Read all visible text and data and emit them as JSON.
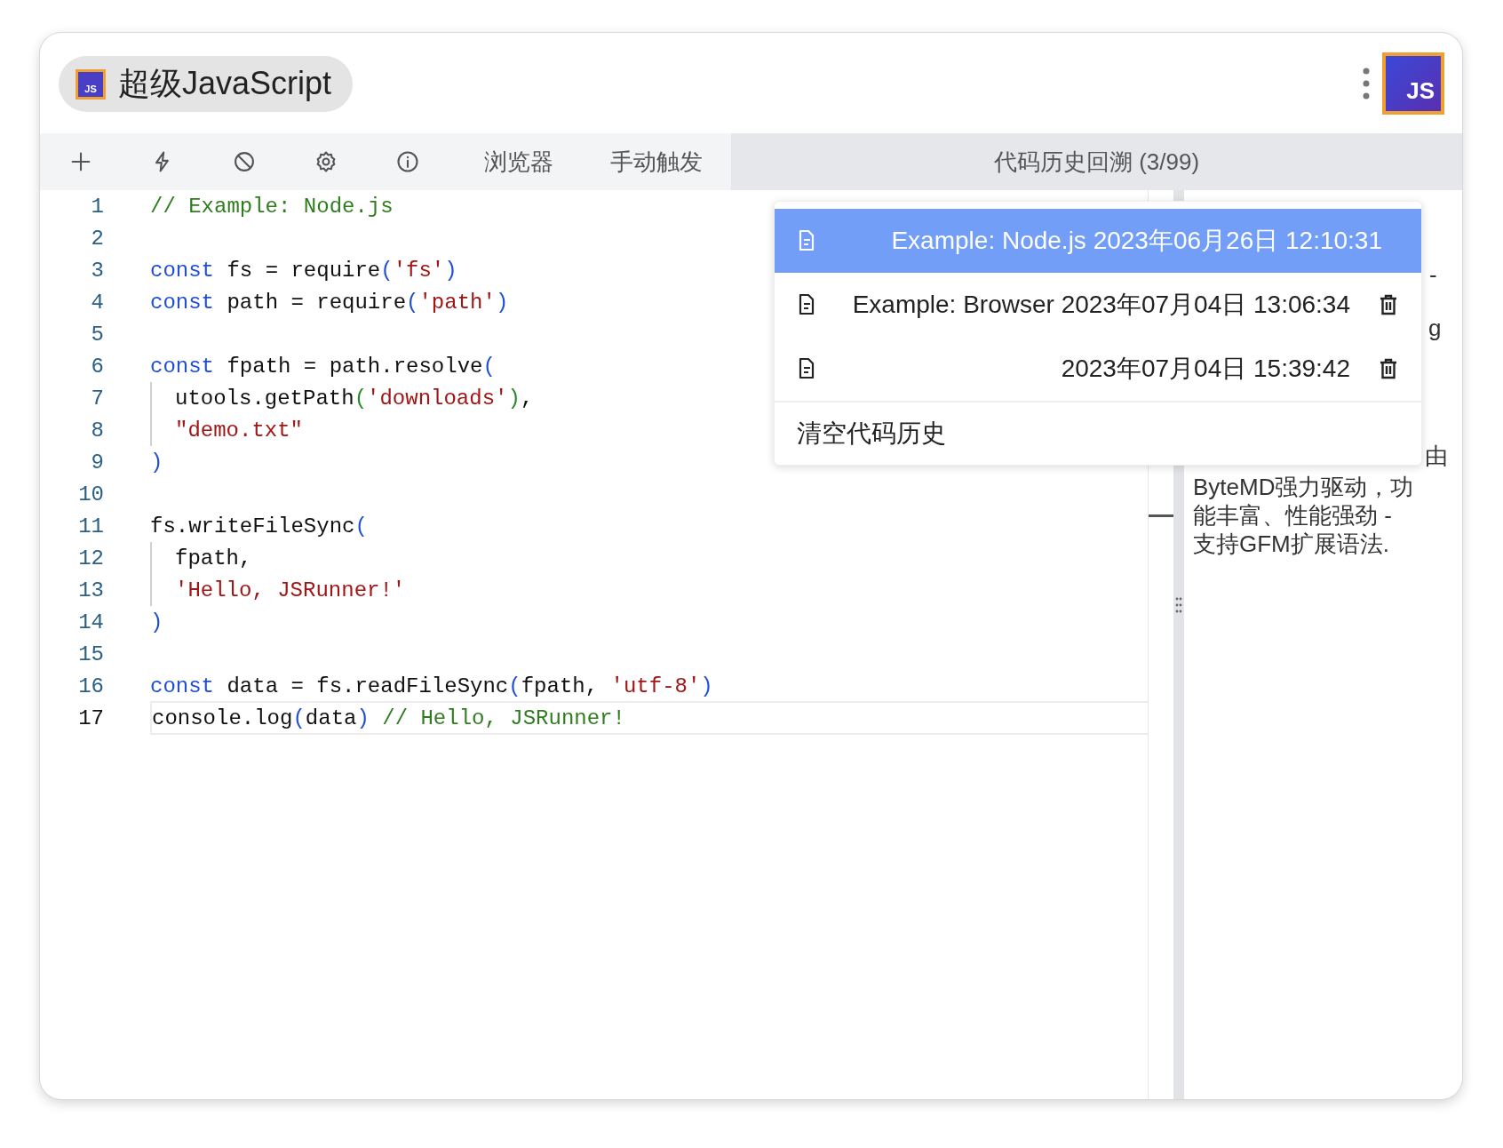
{
  "app": {
    "title": "超级JavaScript",
    "logo_text": "JS",
    "corner_logo_text": "JS"
  },
  "toolbar": {
    "buttons": [
      {
        "kind": "plus"
      },
      {
        "kind": "bolt"
      },
      {
        "kind": "ban"
      },
      {
        "kind": "gear"
      },
      {
        "kind": "info"
      }
    ],
    "tabs": [
      {
        "label": "浏览器",
        "selected": false
      },
      {
        "label": "手动触发",
        "selected": false
      },
      {
        "label": "代码历史回溯 (3/99)",
        "selected": true
      }
    ]
  },
  "editor": {
    "lines": [
      {
        "number": "1",
        "tokens": [
          {
            "kind": "comment",
            "text": "// Example: Node.js"
          }
        ]
      },
      {
        "number": "2"
      },
      {
        "number": "3",
        "tokens": [
          {
            "kind": "keyword",
            "text": "const"
          },
          {
            "kind": "plain",
            "text": " fs = require"
          },
          {
            "kind": "paren",
            "text": "("
          },
          {
            "kind": "string",
            "text": "'fs'"
          },
          {
            "kind": "paren",
            "text": ")"
          }
        ]
      },
      {
        "number": "4",
        "tokens": [
          {
            "kind": "keyword",
            "text": "const"
          },
          {
            "kind": "plain",
            "text": " path = require"
          },
          {
            "kind": "paren",
            "text": "("
          },
          {
            "kind": "string",
            "text": "'path'"
          },
          {
            "kind": "paren",
            "text": ")"
          }
        ]
      },
      {
        "number": "5"
      },
      {
        "number": "6",
        "tokens": [
          {
            "kind": "keyword",
            "text": "const"
          },
          {
            "kind": "plain",
            "text": " fpath = path.resolve"
          },
          {
            "kind": "paren",
            "text": "("
          }
        ]
      },
      {
        "number": "7",
        "indented": true,
        "tokens": [
          {
            "kind": "plain",
            "text": "utools.getPath"
          },
          {
            "kind": "paren2",
            "text": "("
          },
          {
            "kind": "string",
            "text": "'downloads'"
          },
          {
            "kind": "paren2",
            "text": ")"
          },
          {
            "kind": "plain",
            "text": ","
          }
        ]
      },
      {
        "number": "8",
        "indented": true,
        "tokens": [
          {
            "kind": "string",
            "text": "\"demo.txt\""
          }
        ]
      },
      {
        "number": "9",
        "tokens": [
          {
            "kind": "paren",
            "text": ")"
          }
        ]
      },
      {
        "number": "10"
      },
      {
        "number": "11",
        "tokens": [
          {
            "kind": "plain",
            "text": "fs.writeFileSync"
          },
          {
            "kind": "paren",
            "text": "("
          }
        ]
      },
      {
        "number": "12",
        "indented": true,
        "tokens": [
          {
            "kind": "plain",
            "text": "fpath,"
          }
        ]
      },
      {
        "number": "13",
        "indented": true,
        "tokens": [
          {
            "kind": "string",
            "text": "'Hello, JSRunner!'"
          }
        ]
      },
      {
        "number": "14",
        "tokens": [
          {
            "kind": "paren",
            "text": ")"
          }
        ]
      },
      {
        "number": "15"
      },
      {
        "number": "16",
        "tokens": [
          {
            "kind": "keyword",
            "text": "const"
          },
          {
            "kind": "plain",
            "text": " data = fs.readFileSync"
          },
          {
            "kind": "paren",
            "text": "("
          },
          {
            "kind": "plain",
            "text": "fpath, "
          },
          {
            "kind": "string",
            "text": "'utf-8'"
          },
          {
            "kind": "paren",
            "text": ")"
          }
        ]
      },
      {
        "number": "17",
        "current": true,
        "tokens": [
          {
            "kind": "plain",
            "text": "console.log"
          },
          {
            "kind": "paren",
            "text": "("
          },
          {
            "kind": "plain",
            "text": "data"
          },
          {
            "kind": "paren",
            "text": ")"
          },
          {
            "kind": "comment",
            "text": " // Hello, JSRunner!"
          }
        ]
      }
    ]
  },
  "preview": {
    "fragments": [
      "-",
      "g",
      "由"
    ],
    "paragraph_lines": [
      "ByteMD强力驱动，功",
      "能丰富、性能强劲 -",
      "支持GFM扩展语法."
    ]
  },
  "history_menu": {
    "items": [
      {
        "label": "Example: Node.js 2023年06月26日 12:10:31",
        "selected": true,
        "deletable": false
      },
      {
        "label": "Example: Browser 2023年07月04日 13:06:34",
        "selected": false,
        "deletable": true
      },
      {
        "label": "2023年07月04日 15:39:42",
        "selected": false,
        "deletable": true
      }
    ],
    "clear_label": "清空代码历史"
  }
}
